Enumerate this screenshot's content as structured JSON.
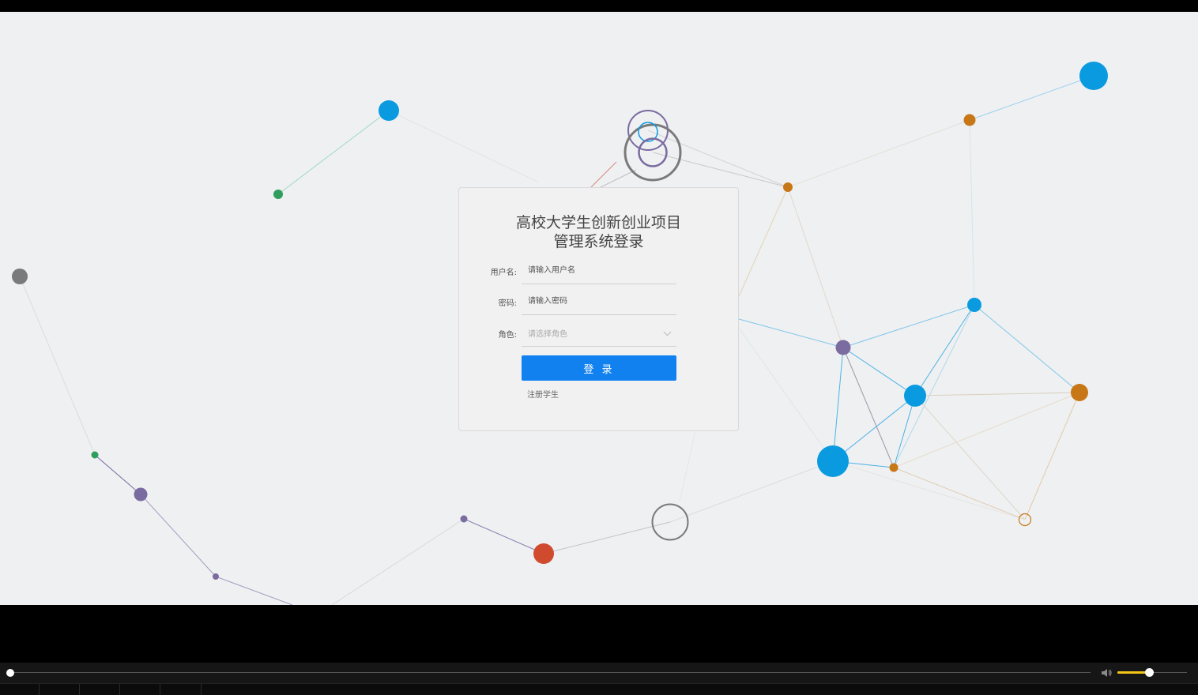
{
  "login": {
    "title": "高校大学生创新创业项目管理系统登录",
    "username_label": "用户名:",
    "username_placeholder": "请输入用户名",
    "password_label": "密码:",
    "password_placeholder": "请输入密码",
    "role_label": "角色:",
    "role_placeholder": "请选择角色",
    "login_button": "登 录",
    "register_link": "注册学生",
    "button_color": "#1181f0"
  },
  "player": {
    "progress": 0.0,
    "volume": 0.45,
    "volume_color": "#f5c518",
    "volume_icon": "speaker-icon"
  },
  "background": {
    "node_colors": [
      "#0a9ae0",
      "#c87716",
      "#7a6ba0",
      "#2f9e5d",
      "#d04a2e",
      "#7a7a7a"
    ]
  }
}
